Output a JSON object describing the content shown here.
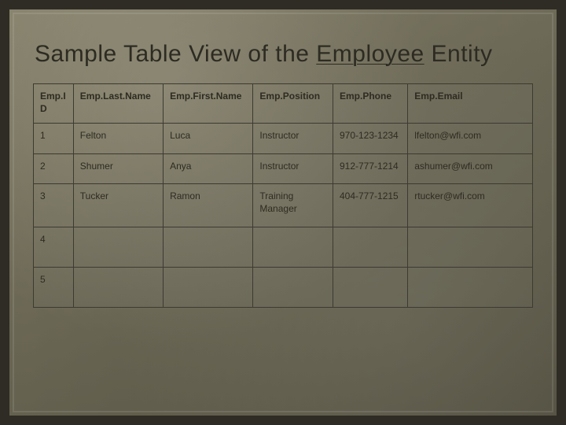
{
  "title_pre": "Sample Table View of the ",
  "title_ul": "Employee",
  "title_post": " Entity",
  "headers": {
    "id": "Emp.ID",
    "last": "Emp.Last.Name",
    "first": "Emp.First.Name",
    "position": "Emp.Position",
    "phone": "Emp.Phone",
    "email": "Emp.Email"
  },
  "rows": [
    {
      "id": "1",
      "last": "Felton",
      "first": "Luca",
      "position": "Instructor",
      "phone": "970-123-1234",
      "email": "lfelton@wfi.com"
    },
    {
      "id": "2",
      "last": "Shumer",
      "first": "Anya",
      "position": "Instructor",
      "phone": "912-777-1214",
      "email": "ashumer@wfi.com"
    },
    {
      "id": "3",
      "last": "Tucker",
      "first": "Ramon",
      "position": "Training Manager",
      "phone": "404-777-1215",
      "email": "rtucker@wfi.com"
    },
    {
      "id": "4",
      "last": "",
      "first": "",
      "position": "",
      "phone": "",
      "email": ""
    },
    {
      "id": "5",
      "last": "",
      "first": "",
      "position": "",
      "phone": "",
      "email": ""
    }
  ]
}
